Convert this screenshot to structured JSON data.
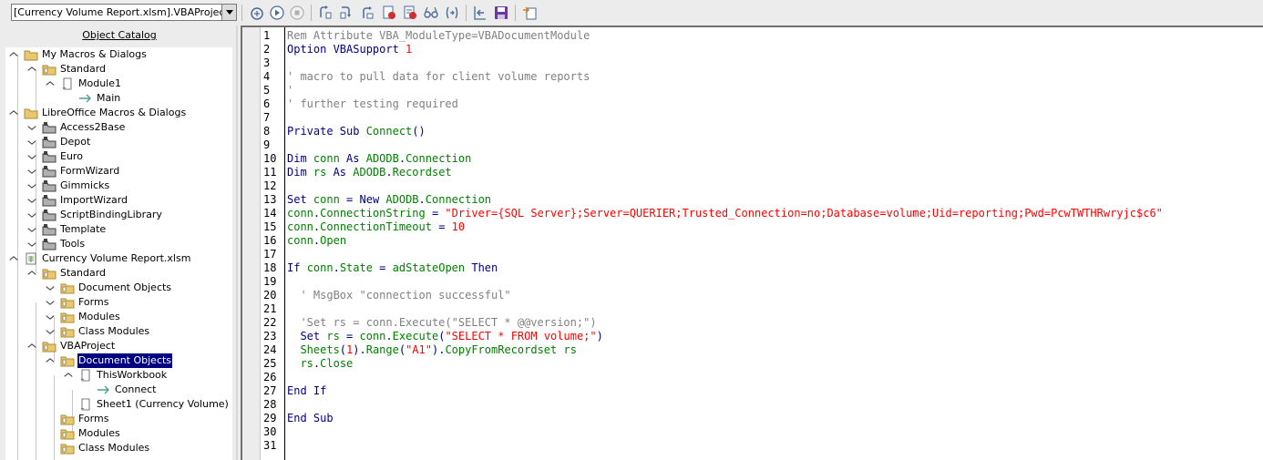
{
  "toolbar": {
    "library_select_value": "[Currency Volume Report.xlsm].VBAProject",
    "buttons": [
      "compile",
      "run",
      "stop",
      "step-over",
      "step-into",
      "step-out",
      "breakpoint",
      "manage-breakpoints",
      "watch",
      "find-parentheses",
      "insert-source-file",
      "save-source-as",
      "import-dialog"
    ]
  },
  "catalog": {
    "title": "Object Catalog",
    "nodes": [
      {
        "label": "My Macros & Dialogs"
      },
      {
        "label": "Standard"
      },
      {
        "label": "Module1"
      },
      {
        "label": "Main"
      },
      {
        "label": "LibreOffice Macros & Dialogs"
      },
      {
        "label": "Access2Base"
      },
      {
        "label": "Depot"
      },
      {
        "label": "Euro"
      },
      {
        "label": "FormWizard"
      },
      {
        "label": "Gimmicks"
      },
      {
        "label": "ImportWizard"
      },
      {
        "label": "ScriptBindingLibrary"
      },
      {
        "label": "Template"
      },
      {
        "label": "Tools"
      },
      {
        "label": "Currency Volume Report.xlsm"
      },
      {
        "label": "Standard"
      },
      {
        "label": "Document Objects"
      },
      {
        "label": "Forms"
      },
      {
        "label": "Modules"
      },
      {
        "label": "Class Modules"
      },
      {
        "label": "VBAProject"
      },
      {
        "label": "Document Objects"
      },
      {
        "label": "ThisWorkbook"
      },
      {
        "label": "Connect"
      },
      {
        "label": "Sheet1 (Currency Volume)"
      },
      {
        "label": "Forms"
      },
      {
        "label": "Modules"
      },
      {
        "label": "Class Modules"
      }
    ]
  },
  "editor": {
    "line_numbers": [
      "1",
      "2",
      "3",
      "4",
      "5",
      "6",
      "7",
      "8",
      "9",
      "10",
      "11",
      "12",
      "13",
      "14",
      "15",
      "16",
      "17",
      "18",
      "19",
      "20",
      "21",
      "22",
      "23",
      "24",
      "25",
      "26",
      "27",
      "28",
      "29",
      "30",
      "31"
    ],
    "lines": [
      [
        {
          "t": "Rem Attribute VBA_ModuleType=VBADocumentModule",
          "c": "cm"
        }
      ],
      [
        {
          "t": "Option VBASupport ",
          "c": "kw"
        },
        {
          "t": "1",
          "c": "nm"
        }
      ],
      [],
      [
        {
          "t": "' macro to pull data for client volume reports",
          "c": "cm"
        }
      ],
      [
        {
          "t": "'",
          "c": "cm"
        }
      ],
      [
        {
          "t": "' further testing required",
          "c": "cm"
        }
      ],
      [],
      [
        {
          "t": "Private Sub ",
          "c": "kw"
        },
        {
          "t": "Connect",
          "c": "id"
        },
        {
          "t": "()",
          "c": "op"
        }
      ],
      [],
      [
        {
          "t": "Dim ",
          "c": "kw"
        },
        {
          "t": "conn",
          "c": "id"
        },
        {
          "t": " As ",
          "c": "kw"
        },
        {
          "t": "ADODB",
          "c": "id"
        },
        {
          "t": ".",
          "c": "op"
        },
        {
          "t": "Connection",
          "c": "id"
        }
      ],
      [
        {
          "t": "Dim ",
          "c": "kw"
        },
        {
          "t": "rs",
          "c": "id"
        },
        {
          "t": " As ",
          "c": "kw"
        },
        {
          "t": "ADODB",
          "c": "id"
        },
        {
          "t": ".",
          "c": "op"
        },
        {
          "t": "Recordset",
          "c": "id"
        }
      ],
      [],
      [
        {
          "t": "Set ",
          "c": "kw"
        },
        {
          "t": "conn",
          "c": "id"
        },
        {
          "t": " = ",
          "c": "op"
        },
        {
          "t": "New ",
          "c": "kw"
        },
        {
          "t": "ADODB",
          "c": "id"
        },
        {
          "t": ".",
          "c": "op"
        },
        {
          "t": "Connection",
          "c": "id"
        }
      ],
      [
        {
          "t": "conn",
          "c": "id"
        },
        {
          "t": ".",
          "c": "op"
        },
        {
          "t": "ConnectionString",
          "c": "id"
        },
        {
          "t": " = ",
          "c": "op"
        },
        {
          "t": "\"Driver={SQL Server};Server=QUERIER;Trusted_Connection=no;Database=volume;Uid=reporting;Pwd=PcwTWTHRwryjc$c6\"",
          "c": "st"
        }
      ],
      [
        {
          "t": "conn",
          "c": "id"
        },
        {
          "t": ".",
          "c": "op"
        },
        {
          "t": "ConnectionTimeout",
          "c": "id"
        },
        {
          "t": " = ",
          "c": "op"
        },
        {
          "t": "10",
          "c": "nm"
        }
      ],
      [
        {
          "t": "conn",
          "c": "id"
        },
        {
          "t": ".",
          "c": "op"
        },
        {
          "t": "Open",
          "c": "id"
        }
      ],
      [],
      [
        {
          "t": "If ",
          "c": "kw"
        },
        {
          "t": "conn",
          "c": "id"
        },
        {
          "t": ".",
          "c": "op"
        },
        {
          "t": "State",
          "c": "id"
        },
        {
          "t": " = ",
          "c": "op"
        },
        {
          "t": "adStateOpen",
          "c": "id"
        },
        {
          "t": " Then",
          "c": "kw"
        }
      ],
      [],
      [
        {
          "t": "  ' MsgBox \"connection successful\"",
          "c": "cm"
        }
      ],
      [],
      [
        {
          "t": "  'Set rs = conn.Execute(\"SELECT * @@version;\")",
          "c": "cm"
        }
      ],
      [
        {
          "t": "  Set ",
          "c": "kw"
        },
        {
          "t": "rs",
          "c": "id"
        },
        {
          "t": " = ",
          "c": "op"
        },
        {
          "t": "conn",
          "c": "id"
        },
        {
          "t": ".",
          "c": "op"
        },
        {
          "t": "Execute",
          "c": "id"
        },
        {
          "t": "(",
          "c": "op"
        },
        {
          "t": "\"SELECT * FROM volume;\"",
          "c": "st"
        },
        {
          "t": ")",
          "c": "op"
        }
      ],
      [
        {
          "t": "  Sheets",
          "c": "id"
        },
        {
          "t": "(",
          "c": "op"
        },
        {
          "t": "1",
          "c": "nm"
        },
        {
          "t": ").",
          "c": "op"
        },
        {
          "t": "Range",
          "c": "id"
        },
        {
          "t": "(",
          "c": "op"
        },
        {
          "t": "\"A1\"",
          "c": "st"
        },
        {
          "t": ").",
          "c": "op"
        },
        {
          "t": "CopyFromRecordset",
          "c": "id"
        },
        {
          "t": " rs",
          "c": "id"
        }
      ],
      [
        {
          "t": "  rs",
          "c": "id"
        },
        {
          "t": ".",
          "c": "op"
        },
        {
          "t": "Close",
          "c": "id"
        }
      ],
      [],
      [
        {
          "t": "End If",
          "c": "kw"
        }
      ],
      [],
      [
        {
          "t": "End Sub",
          "c": "kw"
        }
      ],
      [],
      []
    ]
  },
  "colors": {
    "keyword": "#000080",
    "comment": "#808080",
    "identifier": "#008000",
    "string": "#ff0000",
    "selection": "#000080"
  }
}
